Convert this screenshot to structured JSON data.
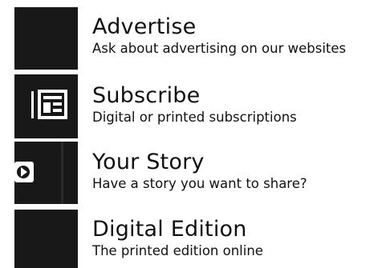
{
  "menu": {
    "items": [
      {
        "title": "Advertise",
        "subtitle": "Ask about advertising on our websites",
        "icon": "blank-tile-icon"
      },
      {
        "title": "Subscribe",
        "subtitle": "Digital or printed subscriptions",
        "icon": "newspaper-icon"
      },
      {
        "title": "Your Story",
        "subtitle": "Have a story you want to share?",
        "icon": "play-story-icon"
      },
      {
        "title": "Digital Edition",
        "subtitle": "The printed edition online",
        "icon": "blank-tile-icon"
      }
    ]
  },
  "colors": {
    "tile": "#181818",
    "text": "#111111",
    "icon": "#ffffff",
    "background": "#ffffff"
  }
}
